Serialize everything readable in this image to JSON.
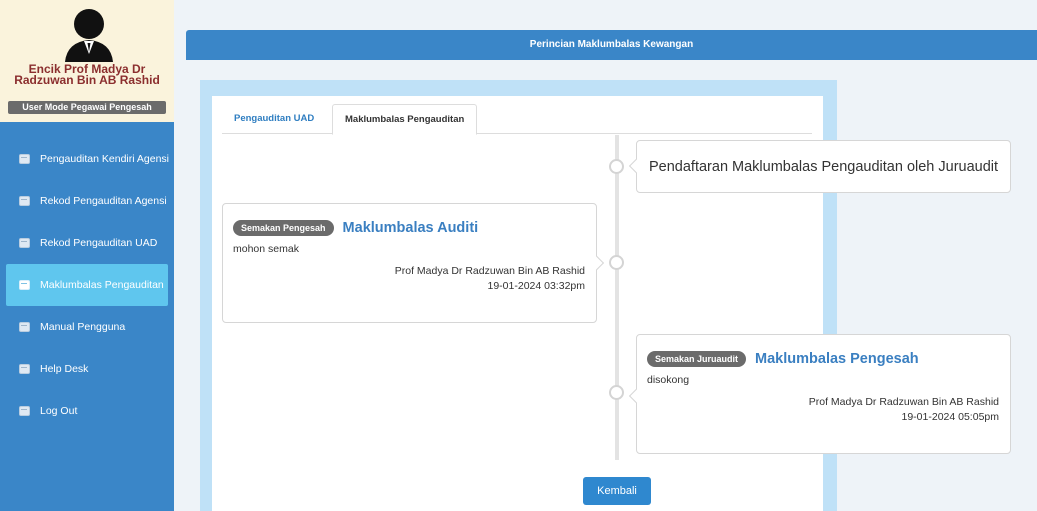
{
  "profile": {
    "name": "Encik Prof Madya Dr Radzuwan Bin AB Rashid",
    "mode": "User Mode Pegawai Pengesah"
  },
  "menu": [
    {
      "label": "Pengauditan Kendiri Agensi",
      "icon": "book-icon",
      "active": false
    },
    {
      "label": "Rekod Pengauditan Agensi",
      "icon": "book-icon",
      "active": false
    },
    {
      "label": "Rekod Pengauditan UAD",
      "icon": "book-icon",
      "active": false
    },
    {
      "label": "Maklumbalas Pengauditan",
      "icon": "book-icon",
      "active": true
    },
    {
      "label": "Manual Pengguna",
      "icon": "book-icon",
      "active": false
    },
    {
      "label": "Help Desk",
      "icon": "book-icon",
      "active": false
    },
    {
      "label": "Log Out",
      "icon": "book-icon",
      "active": false
    }
  ],
  "header": {
    "title": "Perincian Maklumbalas Kewangan"
  },
  "tabs": [
    {
      "label": "Pengauditan UAD"
    },
    {
      "label": "Maklumbalas Pengauditan"
    }
  ],
  "timeline": {
    "top": {
      "title": "Pendaftaran Maklumbalas Pengauditan oleh Juruaudit"
    },
    "left": {
      "badge": "Semakan Pengesah",
      "title": "Maklumbalas Auditi",
      "note": "mohon semak",
      "author": "Prof Madya Dr Radzuwan Bin AB Rashid",
      "datetime": "19-01-2024 03:32pm"
    },
    "right": {
      "badge": "Semakan Juruaudit",
      "title": "Maklumbalas Pengesah",
      "note": "disokong",
      "author": "Prof Madya Dr Radzuwan Bin AB Rashid",
      "datetime": "19-01-2024 05:05pm"
    }
  },
  "actions": {
    "back_label": "Kembali"
  },
  "colors": {
    "primary": "#3a86c8",
    "active": "#5fc6ee",
    "accent_title": "#3a7fc1",
    "badge": "#6b6b6b"
  }
}
